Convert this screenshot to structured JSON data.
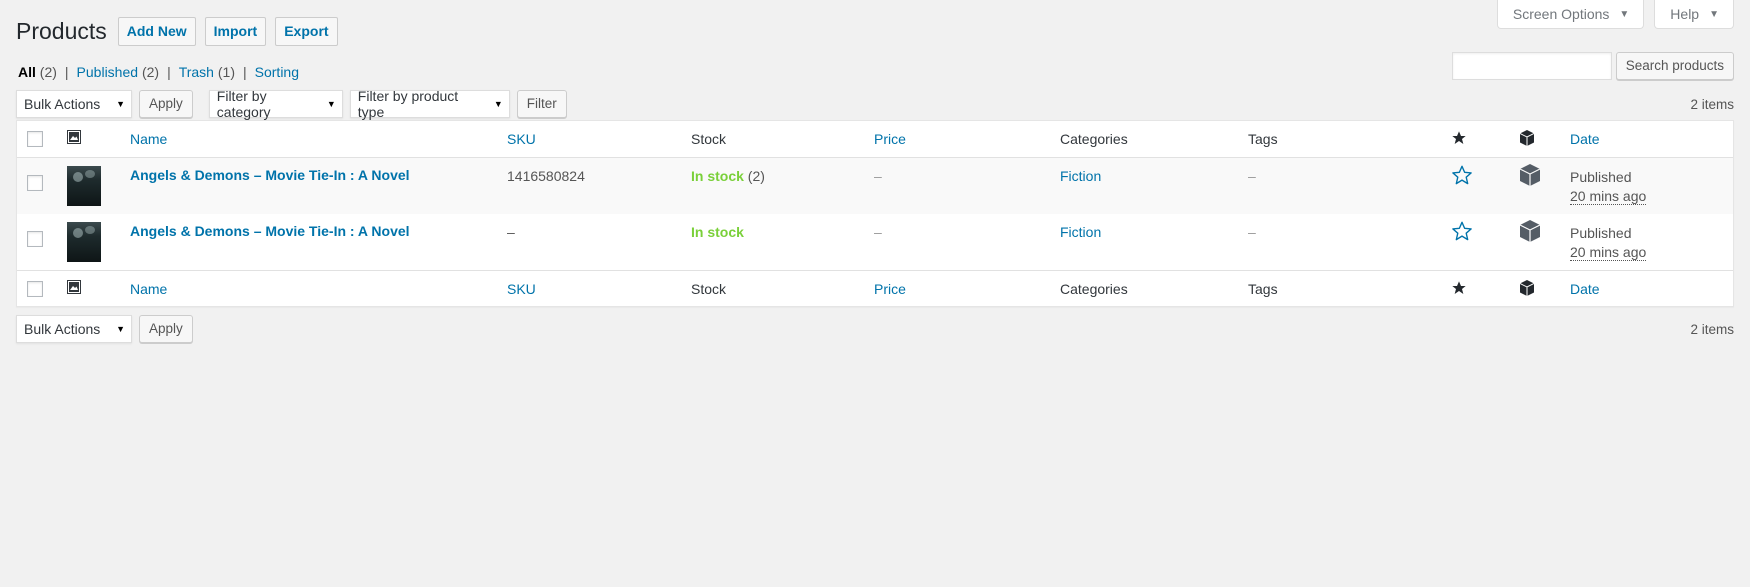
{
  "header": {
    "title": "Products",
    "actions": [
      "Add New",
      "Import",
      "Export"
    ],
    "screen_options": "Screen Options",
    "help": "Help"
  },
  "views": [
    {
      "label": "All",
      "count": "(2)"
    },
    {
      "label": "Published",
      "count": "(2)"
    },
    {
      "label": "Trash",
      "count": "(1)"
    },
    {
      "label": "Sorting",
      "count": ""
    }
  ],
  "search": {
    "value": "",
    "button": "Search products"
  },
  "tablenav": {
    "bulk_actions": "Bulk Actions",
    "apply": "Apply",
    "filter_category": "Filter by category",
    "filter_type": "Filter by product type",
    "filter": "Filter",
    "items": "2 items"
  },
  "columns": {
    "name": "Name",
    "sku": "SKU",
    "stock": "Stock",
    "price": "Price",
    "categories": "Categories",
    "tags": "Tags",
    "date": "Date"
  },
  "rows": [
    {
      "name": "Angels & Demons – Movie Tie-In : A Novel",
      "sku": "1416580824",
      "stock": "In stock",
      "stock_count": "(2)",
      "price": "–",
      "category": "Fiction",
      "tags": "–",
      "status": "Published",
      "date": "20 mins ago"
    },
    {
      "name": "Angels & Demons – Movie Tie-In : A Novel",
      "sku": "–",
      "stock": "In stock",
      "stock_count": "",
      "price": "–",
      "category": "Fiction",
      "tags": "–",
      "status": "Published",
      "date": "20 mins ago"
    }
  ],
  "colors": {
    "link": "#0073aa",
    "in_stock": "#7ad03a",
    "background": "#f1f1f1",
    "product_type_icon": "#555d66"
  },
  "icons": {
    "thumbnail_column": "image-icon",
    "featured_column": "star-filled-icon",
    "type_column": "cube-icon",
    "row_featured": "star-outline-icon",
    "row_type": "cube-icon"
  }
}
